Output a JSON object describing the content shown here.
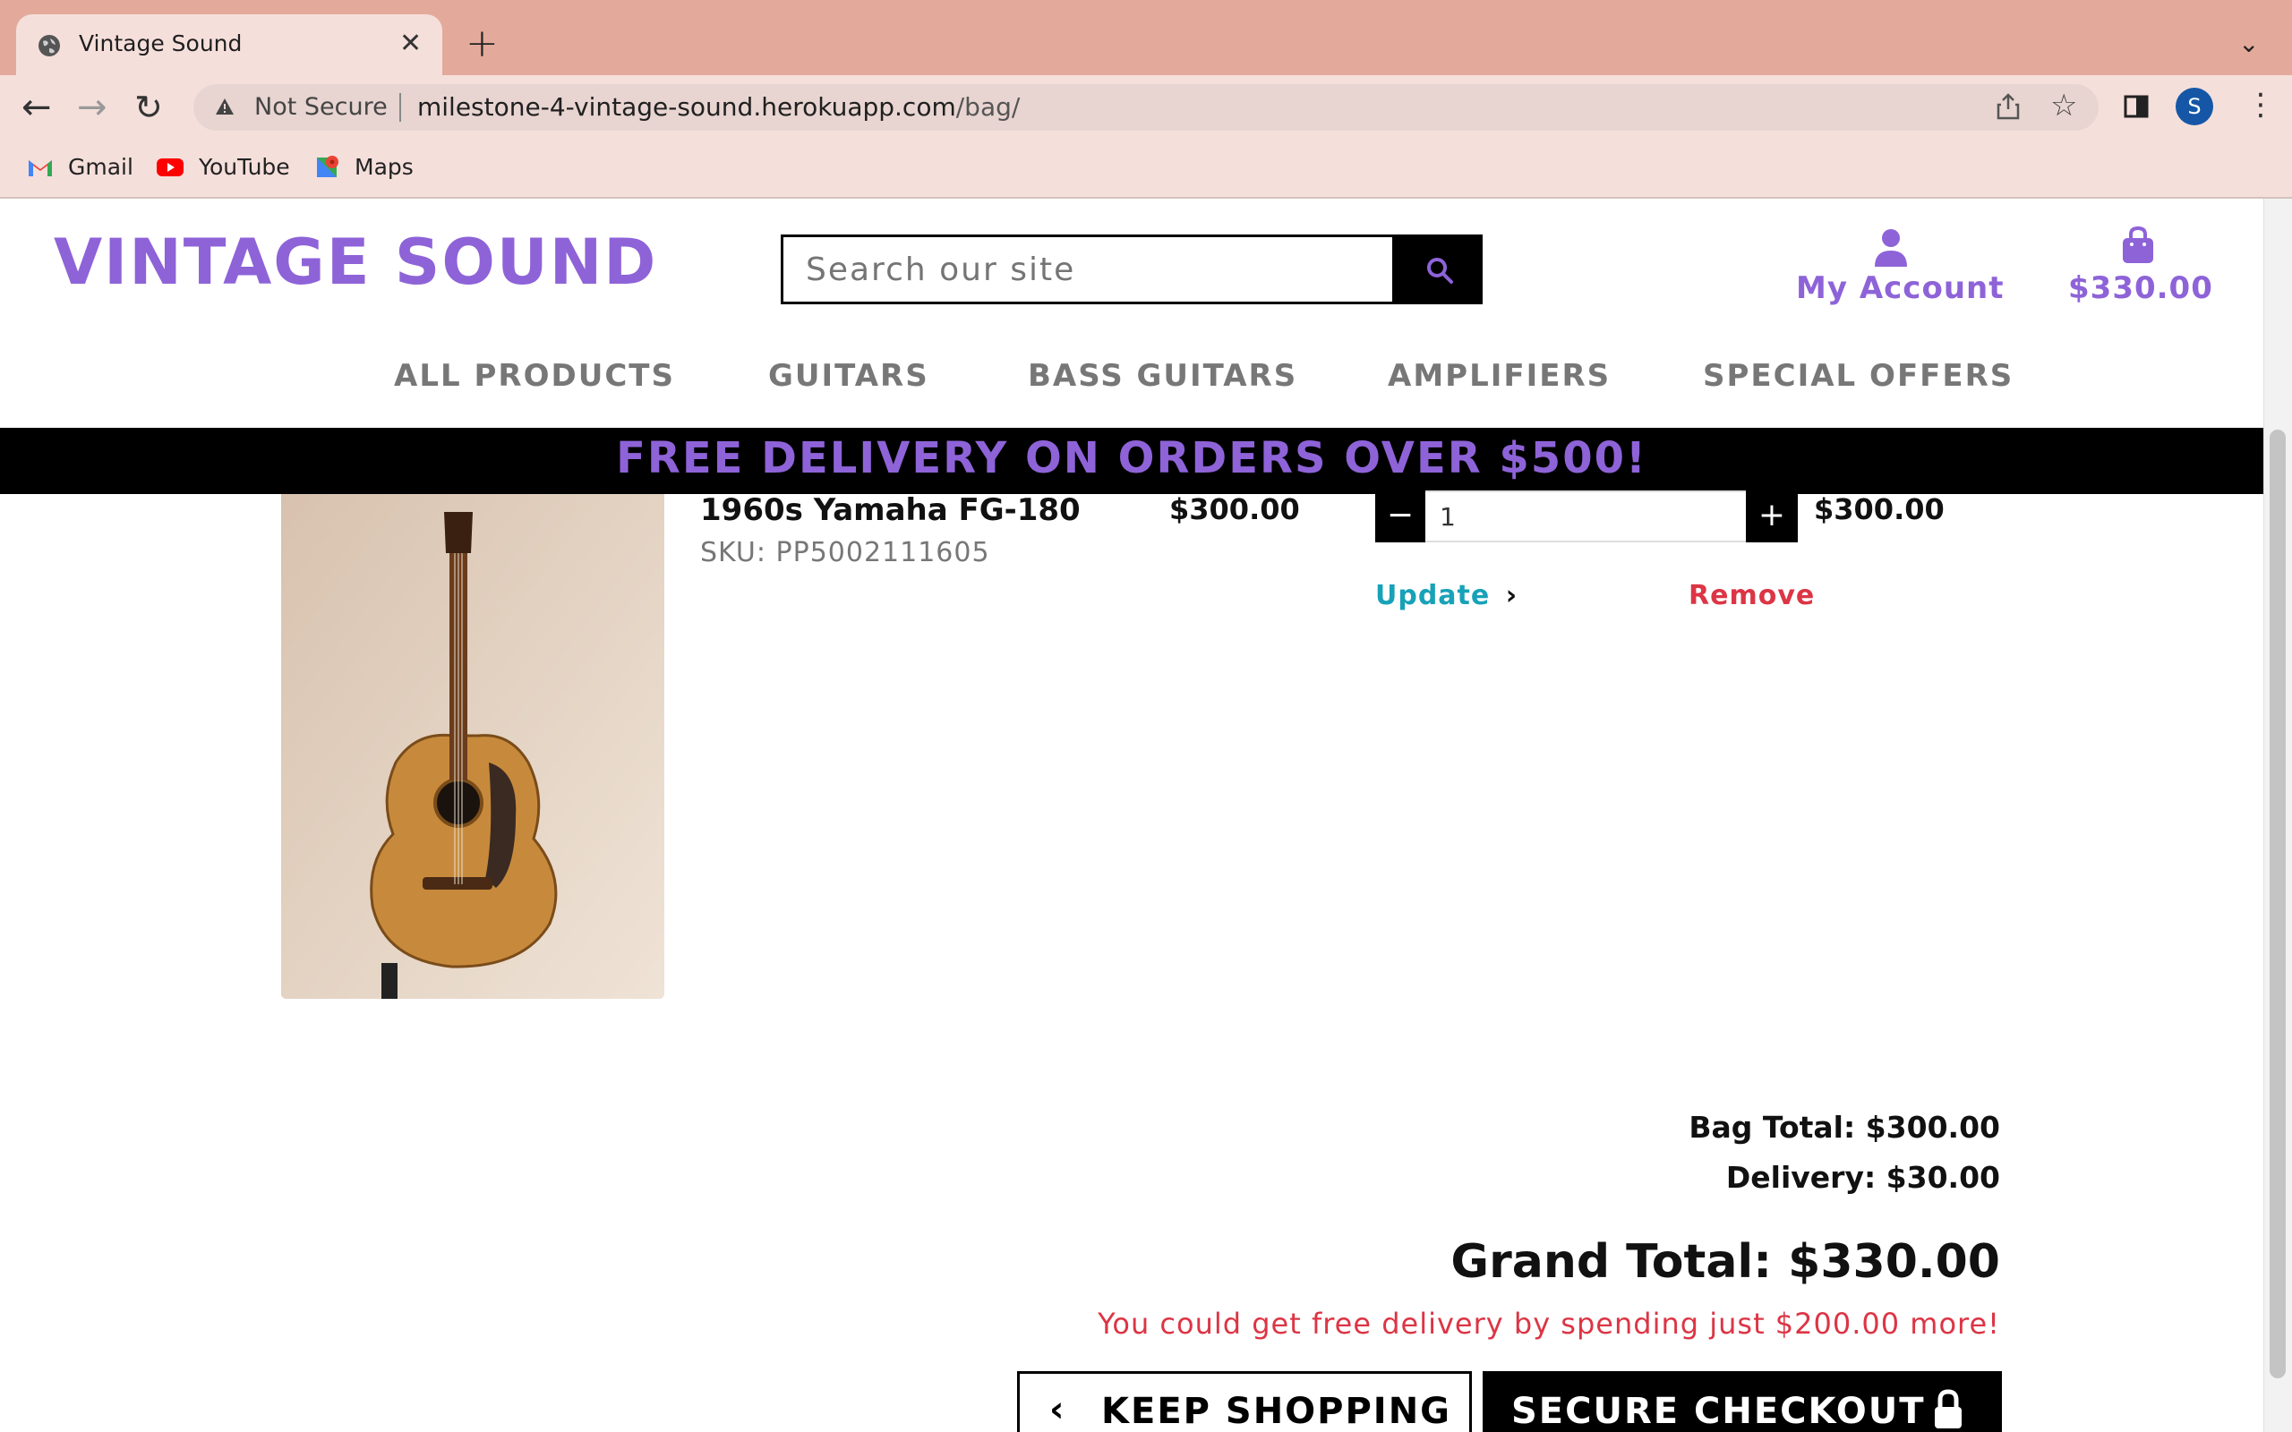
{
  "browser": {
    "tab_title": "Vintage Sound",
    "not_secure": "Not Secure",
    "url_host": "milestone-4-vintage-sound.herokuapp.com",
    "url_path": "/bag/",
    "profile_initial": "S",
    "bookmarks": [
      {
        "label": "Gmail",
        "icon": "gmail-icon"
      },
      {
        "label": "YouTube",
        "icon": "youtube-icon"
      },
      {
        "label": "Maps",
        "icon": "maps-icon"
      }
    ]
  },
  "site": {
    "logo": "VINTAGE SOUND",
    "search_placeholder": "Search our site",
    "account_label": "My Account",
    "cart_total": "$330.00",
    "nav": [
      "ALL PRODUCTS",
      "GUITARS",
      "BASS GUITARS",
      "AMPLIFIERS",
      "SPECIAL OFFERS"
    ],
    "banner": "FREE DELIVERY ON ORDERS OVER $500!",
    "accent_color": "#8e63d8"
  },
  "bag": {
    "item": {
      "name": "1960s Yamaha FG-180",
      "sku": "SKU: PP5002111605",
      "price": "$300.00",
      "quantity": "1",
      "subtotal": "$300.00",
      "update_label": "Update",
      "remove_label": "Remove"
    },
    "bag_total": "Bag Total: $300.00",
    "delivery": "Delivery: $30.00",
    "grand_total": "Grand Total: $330.00",
    "free_delivery_msg": "You could get free delivery by spending just $200.00 more!",
    "keep_shopping": "KEEP SHOPPING",
    "secure_checkout": "SECURE CHECKOUT"
  }
}
